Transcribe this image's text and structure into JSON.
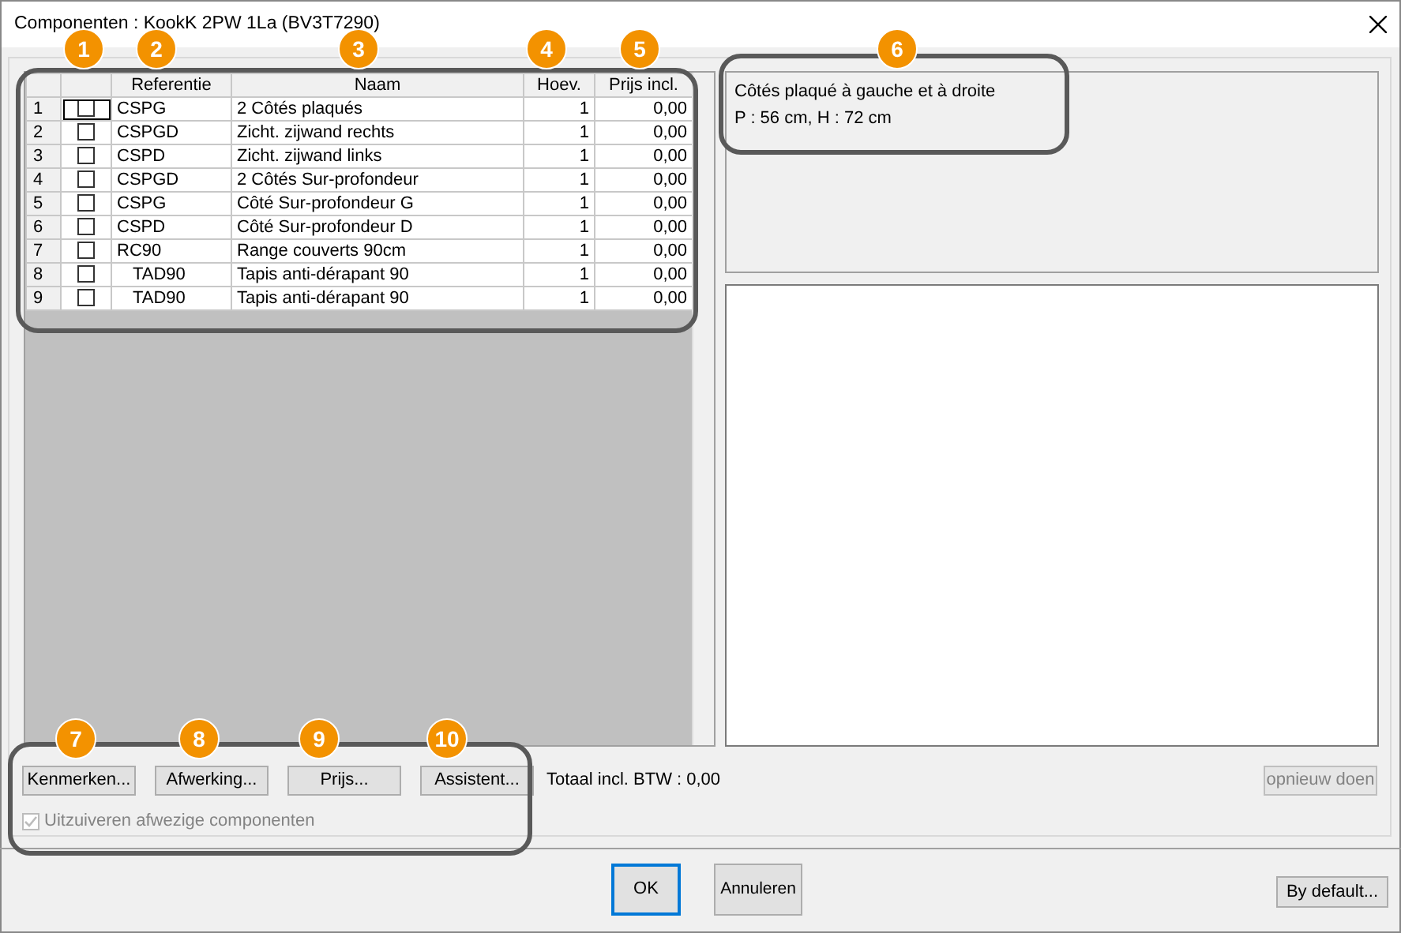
{
  "window": {
    "title": "Componenten : KookK 2PW 1La (BV3T7290)"
  },
  "grid": {
    "columns": [
      {
        "kind": "check"
      },
      {
        "kind": "reference",
        "label": "Referentie"
      },
      {
        "kind": "name",
        "label": "Naam"
      },
      {
        "kind": "quantity",
        "label": "Hoev."
      },
      {
        "kind": "price",
        "label": "Prijs incl."
      }
    ],
    "rows": [
      {
        "number": "1",
        "checked": false,
        "selected": true,
        "reference": "CSPG",
        "name": "2 Côtés plaqués",
        "quantity": "1",
        "price": "0,00"
      },
      {
        "number": "2",
        "checked": false,
        "selected": false,
        "reference": "CSPGD",
        "name": "Zicht. zijwand rechts",
        "quantity": "1",
        "price": "0,00"
      },
      {
        "number": "3",
        "checked": false,
        "selected": false,
        "reference": "CSPD",
        "name": "Zicht. zijwand links",
        "quantity": "1",
        "price": "0,00"
      },
      {
        "number": "4",
        "checked": false,
        "selected": false,
        "reference": "CSPGD",
        "name": "2 Côtés Sur-profondeur",
        "quantity": "1",
        "price": "0,00"
      },
      {
        "number": "5",
        "checked": false,
        "selected": false,
        "reference": "CSPG",
        "name": "Côté Sur-profondeur G",
        "quantity": "1",
        "price": "0,00"
      },
      {
        "number": "6",
        "checked": false,
        "selected": false,
        "reference": "CSPD",
        "name": "Côté Sur-profondeur D",
        "quantity": "1",
        "price": "0,00"
      },
      {
        "number": "7",
        "checked": false,
        "selected": false,
        "reference": "RC90",
        "name": "Range couverts 90cm",
        "quantity": "1",
        "price": "0,00",
        "children": [
          {
            "number": "8",
            "checked": false,
            "selected": false,
            "reference": "TAD90",
            "name": "Tapis anti-dérapant 90",
            "quantity": "1",
            "price": "0,00"
          },
          {
            "number": "9",
            "checked": false,
            "selected": false,
            "reference": "TAD90",
            "name": "Tapis anti-dérapant 90",
            "quantity": "1",
            "price": "0,00"
          }
        ]
      }
    ]
  },
  "description": [
    "Côtés plaqué à gauche et à droite",
    "P : 56 cm, H : 72 cm"
  ],
  "actions": [
    "Kenmerken...",
    "Afwerking...",
    "Prijs...",
    "Assistent..."
  ],
  "total": "Totaal incl. BTW : 0,00",
  "redo_button": {
    "label": "opnieuw doen",
    "disabled": true
  },
  "purge_checkbox": {
    "label": "Uitzuiveren afwezige componenten",
    "checked": true,
    "disabled": true
  },
  "footer_buttons": [
    {
      "label": "OK",
      "default": true
    },
    {
      "label": "Annuleren",
      "default": false
    },
    {
      "label": "By default...",
      "default": false
    }
  ],
  "annotations": [
    "1",
    "2",
    "3",
    "4",
    "5",
    "6",
    "7",
    "8",
    "9",
    "10"
  ]
}
